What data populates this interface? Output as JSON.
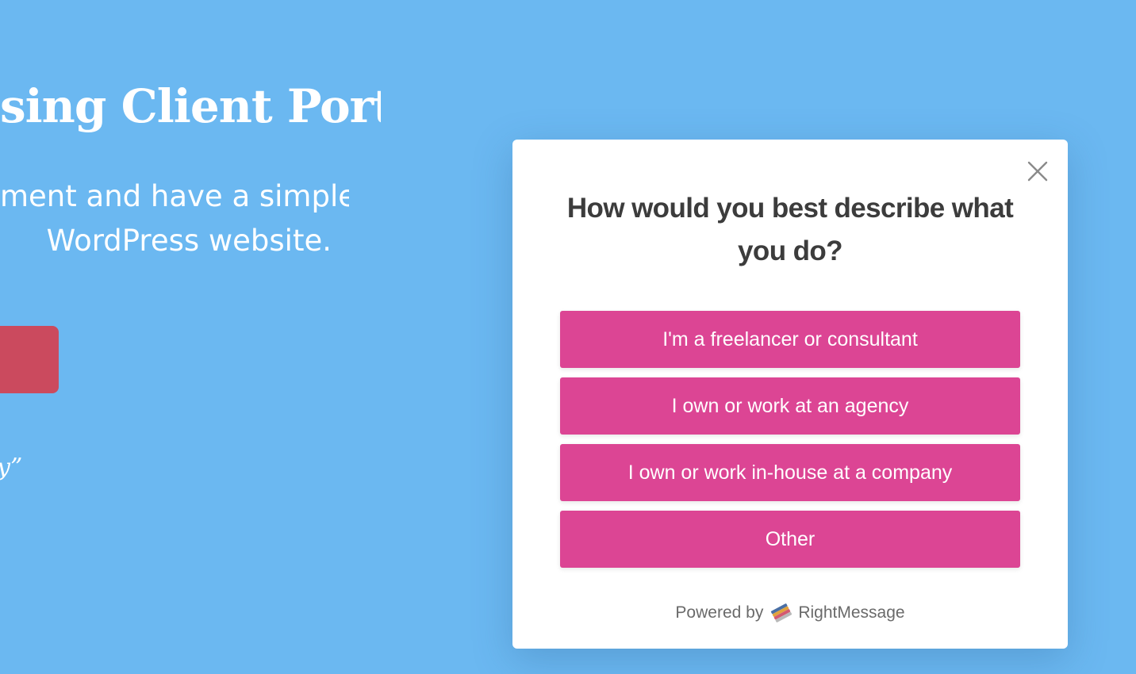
{
  "background_page": {
    "heading": "sing Client Portal",
    "subtext_lines": [
      "ment and have a simple",
      "WordPress website."
    ],
    "quote_fragment": "y”"
  },
  "modal": {
    "title": "How would you best describe what you do?",
    "close_icon": "close-icon",
    "options": [
      {
        "label": "I'm a freelancer or consultant"
      },
      {
        "label": "I own or work at an agency"
      },
      {
        "label": "I own or work in-house at a company"
      },
      {
        "label": "Other"
      }
    ],
    "powered_by_label": "Powered by",
    "brand_name": "RightMessage",
    "brand_icon": "rightmessage-logo-icon"
  },
  "colors": {
    "page_background": "#6bb8f1",
    "option_button": "#dc4594",
    "cta_button": "#cb4a5e",
    "modal_background": "#ffffff"
  }
}
